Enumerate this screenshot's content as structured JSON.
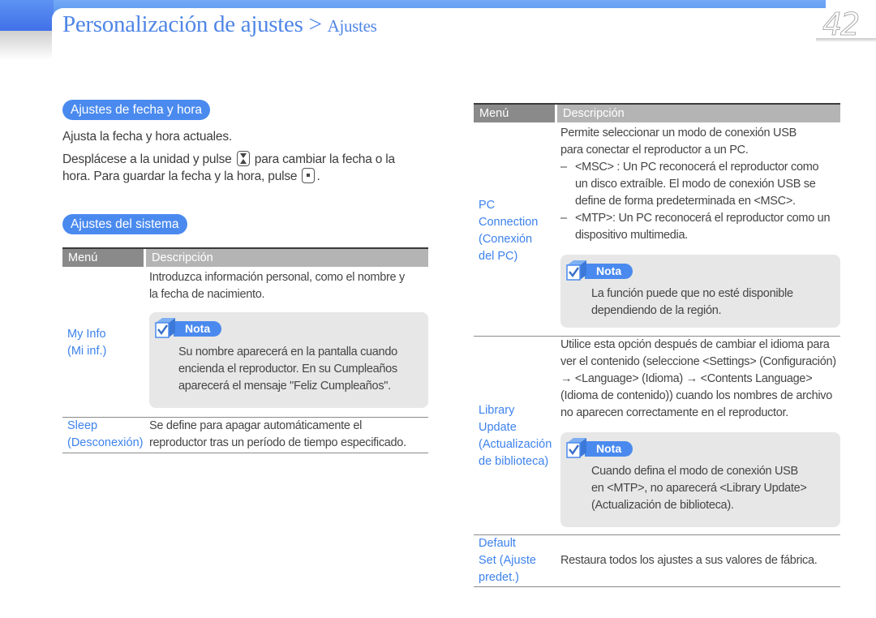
{
  "header": {
    "title_main": "Personalización de ajustes",
    "separator": ">",
    "title_sub": "Ajustes",
    "page_number": "42"
  },
  "left": {
    "section1": {
      "pill": "Ajustes de fecha y hora",
      "line1": "Ajusta la fecha y hora actuales.",
      "line2_a": "Desplácese a la unidad y pulse",
      "line2_b": "para cambiar la fecha o la",
      "line3_a": "hora. Para guardar la fecha y la hora, pulse",
      "line3_b": "."
    },
    "section2": {
      "pill": "Ajustes del sistema"
    },
    "table": {
      "col_menu": "Menú",
      "col_desc": "Descripción",
      "rows": [
        {
          "menu": [
            "My Info",
            "(Mi inf.)"
          ],
          "desc": [
            "Introduzca información personal, como el nombre y",
            "la fecha de nacimiento."
          ],
          "note": {
            "label": "Nota",
            "lines": [
              "Su nombre aparecerá en la pantalla cuando",
              "encienda el reproductor. En su Cumpleaños",
              "aparecerá el mensaje  \"Feliz Cumpleaños\"."
            ]
          }
        },
        {
          "menu": [
            "Sleep",
            "(Desconexión)"
          ],
          "desc": [
            "Se define para apagar automáticamente el",
            "reproductor tras un período de tiempo especificado."
          ]
        }
      ]
    }
  },
  "right": {
    "table": {
      "col_menu": "Menú",
      "col_desc": "Descripción",
      "rows": [
        {
          "menu": [
            "PC",
            "Connection",
            "(Conexión",
            "del PC)"
          ],
          "desc": [
            "Permite seleccionar un modo de conexión USB",
            "para conectar el reproductor a un PC.",
            "<MSC> : Un PC reconocerá el reproductor como",
            "un disco extraíble. El modo de conexión USB se",
            "define de forma predeterminada en <MSC>.",
            "<MTP>: Un PC reconocerá el reproductor como un",
            "dispositivo multimedia."
          ],
          "dash": "–",
          "note": {
            "label": "Nota",
            "lines": [
              "La función puede que no esté disponible",
              "dependiendo de la región."
            ]
          }
        },
        {
          "menu": [
            "Library",
            "Update",
            "(Actualización",
            "de biblioteca)"
          ],
          "desc": [
            "Utilice esta opción después de cambiar el idioma para",
            "ver el contenido (seleccione <Settings> (Configuración)",
            "→ <Language> (Idioma)  → <Contents Language>",
            "(Idioma de contenido)) cuando los nombres de archivo",
            "no aparecen correctamente en el reproductor."
          ],
          "note": {
            "label": "Nota",
            "lines": [
              "Cuando defina el modo de conexión USB",
              "en <MTP>, no aparecerá <Library Update>",
              "(Actualización de biblioteca)."
            ]
          }
        },
        {
          "menu": [
            "Default",
            "Set (Ajuste",
            "predet.)"
          ],
          "desc": [
            "Restaura todos los ajustes a sus valores de fábrica."
          ]
        }
      ]
    }
  },
  "colors": {
    "accent_blue": "#4a8aef",
    "menu_text_blue": "#3d82ec",
    "title_blue": "#4f86e6",
    "header_gray_dark": "#8a8a8a",
    "header_gray_light": "#b4b4b4",
    "note_bg": "#e7e7e7"
  }
}
